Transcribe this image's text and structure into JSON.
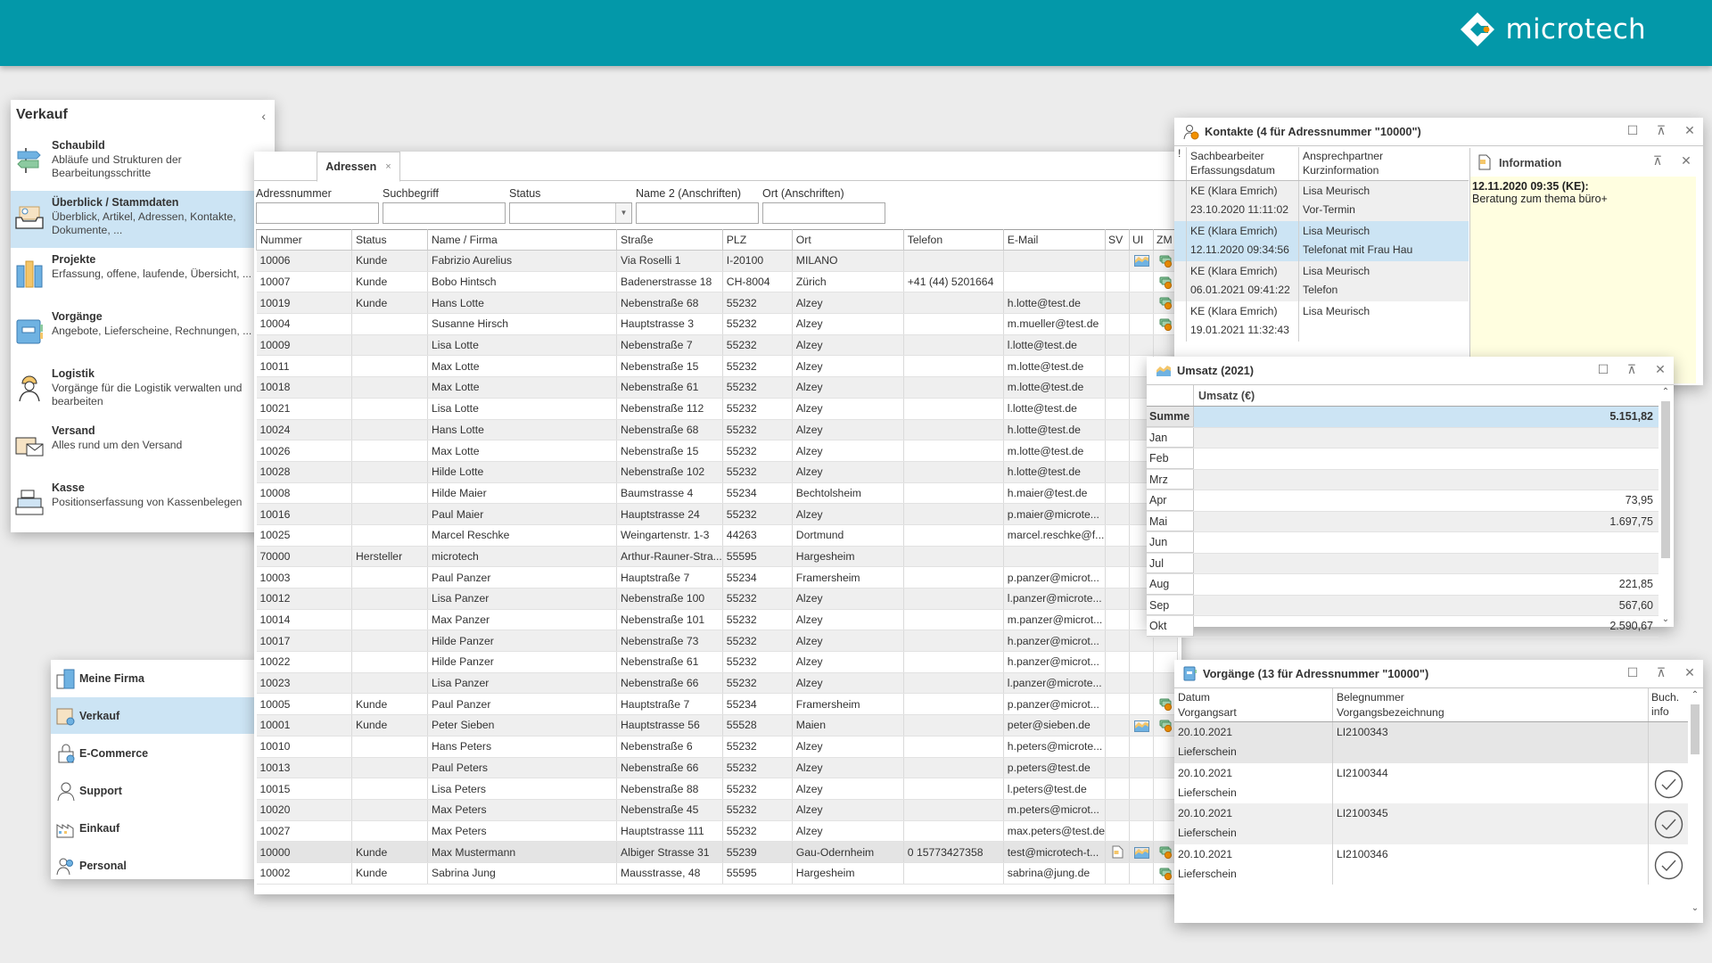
{
  "brand": {
    "name": "microtech",
    "header_color": "#0398a9",
    "accent_orange": "#f29100",
    "selection_color": "#cce4f4"
  },
  "module_panel": {
    "title": "Verkauf",
    "collapse_icon": "chevron-left-icon",
    "items": [
      {
        "title": "Schaubild",
        "desc": "Abläufe und Strukturen der Bearbeitungsschritte",
        "icon": "signpost-icon",
        "active": false
      },
      {
        "title": "Überblick / Stammdaten",
        "desc": "Überblick, Artikel, Adressen, Kontakte, Dokumente, ...",
        "icon": "address-card-icon",
        "active": true
      },
      {
        "title": "Projekte",
        "desc": "Erfassung, offene, laufende, Übersicht, ...",
        "icon": "binders-icon",
        "active": false
      },
      {
        "title": "Vorgänge",
        "desc": "Angebote, Lieferscheine, Rechnungen, ...",
        "icon": "folder-icon",
        "active": false
      },
      {
        "title": "Logistik",
        "desc": "Vorgänge für die Logistik verwalten und bearbeiten",
        "icon": "worker-icon",
        "active": false
      },
      {
        "title": "Versand",
        "desc": "Alles rund um den Versand",
        "icon": "shipping-icon",
        "active": false
      },
      {
        "title": "Kasse",
        "desc": "Positionserfassung von Kassenbelegen",
        "icon": "cash-register-icon",
        "active": false
      }
    ]
  },
  "nav": {
    "items": [
      {
        "label": "Meine Firma",
        "icon": "building-icon",
        "active": false
      },
      {
        "label": "Verkauf",
        "icon": "box-search-icon",
        "active": true
      },
      {
        "label": "E-Commerce",
        "icon": "shop-icon",
        "active": false
      },
      {
        "label": "Support",
        "icon": "user-support-icon",
        "active": false
      },
      {
        "label": "Einkauf",
        "icon": "factory-icon",
        "active": false
      },
      {
        "label": "Personal",
        "icon": "people-icon",
        "active": false
      }
    ]
  },
  "adressen": {
    "tab_label": "Adressen",
    "tab_close": "×",
    "filters": [
      {
        "label": "Adressnummer",
        "value": "",
        "type": "text"
      },
      {
        "label": "Suchbegriff",
        "value": "",
        "type": "text"
      },
      {
        "label": "Status",
        "value": "",
        "type": "select"
      },
      {
        "label": "Name 2 (Anschriften)",
        "value": "",
        "type": "text"
      },
      {
        "label": "Ort (Anschriften)",
        "value": "",
        "type": "text"
      }
    ],
    "columns": [
      "Nummer",
      "Status",
      "Name / Firma",
      "Straße",
      "PLZ",
      "Ort",
      "Telefon",
      "E-Mail",
      "SV",
      "UI",
      "ZM"
    ],
    "rows": [
      {
        "nr": "10006",
        "status": "Kunde",
        "name": "Fabrizio Aurelius",
        "strasse": "Via Roselli 1",
        "plz": "I-20100",
        "ort": "MILANO",
        "tel": "",
        "mail": "",
        "sv": "",
        "ui": "chart",
        "zm": "coins"
      },
      {
        "nr": "10007",
        "status": "Kunde",
        "name": "Bobo Hintsch",
        "strasse": "Badenerstrasse 18",
        "plz": "CH-8004",
        "ort": "Zürich",
        "tel": "+41 (44) 5201664",
        "mail": "",
        "sv": "",
        "ui": "",
        "zm": "coins"
      },
      {
        "nr": "10019",
        "status": "Kunde",
        "name": "Hans Lotte",
        "strasse": "Nebenstraße 68",
        "plz": "55232",
        "ort": "Alzey",
        "tel": "",
        "mail": "h.lotte@test.de",
        "sv": "",
        "ui": "",
        "zm": "coins"
      },
      {
        "nr": "10004",
        "status": "",
        "name": "Susanne Hirsch",
        "strasse": "Hauptstrasse 3",
        "plz": "55232",
        "ort": "Alzey",
        "tel": "",
        "mail": "m.mueller@test.de",
        "sv": "",
        "ui": "",
        "zm": "coins"
      },
      {
        "nr": "10009",
        "status": "",
        "name": "Lisa Lotte",
        "strasse": "Nebenstraße 7",
        "plz": "55232",
        "ort": "Alzey",
        "tel": "",
        "mail": "l.lotte@test.de",
        "sv": "",
        "ui": "",
        "zm": ""
      },
      {
        "nr": "10011",
        "status": "",
        "name": "Max Lotte",
        "strasse": "Nebenstraße 15",
        "plz": "55232",
        "ort": "Alzey",
        "tel": "",
        "mail": "m.lotte@test.de",
        "sv": "",
        "ui": "",
        "zm": ""
      },
      {
        "nr": "10018",
        "status": "",
        "name": "Max Lotte",
        "strasse": "Nebenstraße 61",
        "plz": "55232",
        "ort": "Alzey",
        "tel": "",
        "mail": "m.lotte@test.de",
        "sv": "",
        "ui": "",
        "zm": ""
      },
      {
        "nr": "10021",
        "status": "",
        "name": "Lisa Lotte",
        "strasse": "Nebenstraße 112",
        "plz": "55232",
        "ort": "Alzey",
        "tel": "",
        "mail": "l.lotte@test.de",
        "sv": "",
        "ui": "",
        "zm": ""
      },
      {
        "nr": "10024",
        "status": "",
        "name": "Hans Lotte",
        "strasse": "Nebenstraße 68",
        "plz": "55232",
        "ort": "Alzey",
        "tel": "",
        "mail": "h.lotte@test.de",
        "sv": "",
        "ui": "",
        "zm": ""
      },
      {
        "nr": "10026",
        "status": "",
        "name": "Max Lotte",
        "strasse": "Nebenstraße 15",
        "plz": "55232",
        "ort": "Alzey",
        "tel": "",
        "mail": "m.lotte@test.de",
        "sv": "",
        "ui": "",
        "zm": ""
      },
      {
        "nr": "10028",
        "status": "",
        "name": "Hilde Lotte",
        "strasse": "Nebenstraße 102",
        "plz": "55232",
        "ort": "Alzey",
        "tel": "",
        "mail": "h.lotte@test.de",
        "sv": "",
        "ui": "",
        "zm": ""
      },
      {
        "nr": "10008",
        "status": "",
        "name": "Hilde Maier",
        "strasse": "Baumstrasse 4",
        "plz": "55234",
        "ort": "Bechtolsheim",
        "tel": "",
        "mail": "h.maier@test.de",
        "sv": "",
        "ui": "",
        "zm": ""
      },
      {
        "nr": "10016",
        "status": "",
        "name": "Paul Maier",
        "strasse": "Hauptstrasse 24",
        "plz": "55232",
        "ort": "Alzey",
        "tel": "",
        "mail": "p.maier@microte...",
        "sv": "",
        "ui": "",
        "zm": ""
      },
      {
        "nr": "10025",
        "status": "",
        "name": "Marcel Reschke",
        "strasse": "Weingartenstr. 1-3",
        "plz": "44263",
        "ort": "Dortmund",
        "tel": "",
        "mail": "marcel.reschke@f...",
        "sv": "",
        "ui": "",
        "zm": ""
      },
      {
        "nr": "70000",
        "status": "Hersteller",
        "name": "microtech",
        "strasse": "Arthur-Rauner-Stra...",
        "plz": "55595",
        "ort": "Hargesheim",
        "tel": "",
        "mail": "",
        "sv": "",
        "ui": "",
        "zm": ""
      },
      {
        "nr": "10003",
        "status": "",
        "name": "Paul Panzer",
        "strasse": "Hauptstraße 7",
        "plz": "55234",
        "ort": "Framersheim",
        "tel": "",
        "mail": "p.panzer@microt...",
        "sv": "",
        "ui": "",
        "zm": ""
      },
      {
        "nr": "10012",
        "status": "",
        "name": "Lisa Panzer",
        "strasse": "Nebenstraße 100",
        "plz": "55232",
        "ort": "Alzey",
        "tel": "",
        "mail": "l.panzer@microte...",
        "sv": "",
        "ui": "",
        "zm": ""
      },
      {
        "nr": "10014",
        "status": "",
        "name": "Max Panzer",
        "strasse": "Nebenstraße 101",
        "plz": "55232",
        "ort": "Alzey",
        "tel": "",
        "mail": "m.panzer@microt...",
        "sv": "",
        "ui": "",
        "zm": ""
      },
      {
        "nr": "10017",
        "status": "",
        "name": "Hilde Panzer",
        "strasse": "Nebenstraße 73",
        "plz": "55232",
        "ort": "Alzey",
        "tel": "",
        "mail": "h.panzer@microt...",
        "sv": "",
        "ui": "",
        "zm": ""
      },
      {
        "nr": "10022",
        "status": "",
        "name": "Hilde Panzer",
        "strasse": "Nebenstraße 61",
        "plz": "55232",
        "ort": "Alzey",
        "tel": "",
        "mail": "h.panzer@microt...",
        "sv": "",
        "ui": "",
        "zm": ""
      },
      {
        "nr": "10023",
        "status": "",
        "name": "Lisa Panzer",
        "strasse": "Nebenstraße 66",
        "plz": "55232",
        "ort": "Alzey",
        "tel": "",
        "mail": "l.panzer@microte...",
        "sv": "",
        "ui": "",
        "zm": ""
      },
      {
        "nr": "10005",
        "status": "Kunde",
        "name": "Paul Panzer",
        "strasse": "Hauptstraße 7",
        "plz": "55234",
        "ort": "Framersheim",
        "tel": "",
        "mail": "p.panzer@microt...",
        "sv": "",
        "ui": "",
        "zm": "coins"
      },
      {
        "nr": "10001",
        "status": "Kunde",
        "name": "Peter Sieben",
        "strasse": "Hauptstrasse 56",
        "plz": "55528",
        "ort": "Maien",
        "tel": "",
        "mail": "peter@sieben.de",
        "sv": "",
        "ui": "chart",
        "zm": "coins"
      },
      {
        "nr": "10010",
        "status": "",
        "name": "Hans Peters",
        "strasse": "Nebenstraße 6",
        "plz": "55232",
        "ort": "Alzey",
        "tel": "",
        "mail": "h.peters@microte...",
        "sv": "",
        "ui": "",
        "zm": ""
      },
      {
        "nr": "10013",
        "status": "",
        "name": "Paul Peters",
        "strasse": "Nebenstraße 66",
        "plz": "55232",
        "ort": "Alzey",
        "tel": "",
        "mail": "p.peters@test.de",
        "sv": "",
        "ui": "",
        "zm": ""
      },
      {
        "nr": "10015",
        "status": "",
        "name": "Lisa Peters",
        "strasse": "Nebenstraße 88",
        "plz": "55232",
        "ort": "Alzey",
        "tel": "",
        "mail": "l.peters@test.de",
        "sv": "",
        "ui": "",
        "zm": ""
      },
      {
        "nr": "10020",
        "status": "",
        "name": "Max Peters",
        "strasse": "Nebenstraße 45",
        "plz": "55232",
        "ort": "Alzey",
        "tel": "",
        "mail": "m.peters@microt...",
        "sv": "",
        "ui": "",
        "zm": ""
      },
      {
        "nr": "10027",
        "status": "",
        "name": "Max Peters",
        "strasse": "Hauptstrasse 111",
        "plz": "55232",
        "ort": "Alzey",
        "tel": "",
        "mail": "max.peters@test.de",
        "sv": "",
        "ui": "",
        "zm": ""
      },
      {
        "nr": "10000",
        "status": "Kunde",
        "name": "Max Mustermann",
        "strasse": "Albiger Strasse 31",
        "plz": "55239",
        "ort": "Gau-Odernheim",
        "tel": "0 15773427358",
        "mail": "test@microtech-t...",
        "sv": "doc",
        "ui": "chart",
        "zm": "coins",
        "selected": true
      },
      {
        "nr": "10002",
        "status": "Kunde",
        "name": "Sabrina Jung",
        "strasse": "Mausstrasse, 48",
        "plz": "55595",
        "ort": "Hargesheim",
        "tel": "",
        "mail": "sabrina@jung.de",
        "sv": "",
        "ui": "",
        "zm": "coins"
      }
    ]
  },
  "kontakte": {
    "title": "Kontakte (4 für Adressnummer \"10000\")",
    "col_flag": "!",
    "col1": [
      "Sachbearbeiter",
      "Erfassungsdatum"
    ],
    "col2": [
      "Ansprechpartner",
      "Kurzinformation"
    ],
    "rows": [
      {
        "bearbeiter": "KE (Klara Emrich)",
        "datum": "23.10.2020 11:11:02",
        "partner": "Lisa Meurisch",
        "info": "Vor-Termin",
        "selected": false
      },
      {
        "bearbeiter": "KE (Klara Emrich)",
        "datum": "12.11.2020 09:34:56",
        "partner": "Lisa Meurisch",
        "info": "Telefonat mit Frau Hau",
        "selected": true
      },
      {
        "bearbeiter": "KE (Klara Emrich)",
        "datum": "06.01.2021 09:41:22",
        "partner": "Lisa Meurisch",
        "info": "Telefon",
        "selected": false
      },
      {
        "bearbeiter": "KE (Klara Emrich)",
        "datum": "19.01.2021 11:32:43",
        "partner": "Lisa Meurisch",
        "info": "",
        "selected": false
      }
    ],
    "information": {
      "title": "Information",
      "heading": "12.11.2020 09:35 (KE):",
      "text": "Beratung zum thema büro+"
    }
  },
  "umsatz": {
    "title": "Umsatz (2021)",
    "column": "Umsatz (€)",
    "sum_label": "Summe",
    "sum_value": "5.151,82",
    "months": [
      {
        "m": "Jan",
        "v": ""
      },
      {
        "m": "Feb",
        "v": ""
      },
      {
        "m": "Mrz",
        "v": ""
      },
      {
        "m": "Apr",
        "v": "73,95"
      },
      {
        "m": "Mai",
        "v": "1.697,75"
      },
      {
        "m": "Jun",
        "v": ""
      },
      {
        "m": "Jul",
        "v": ""
      },
      {
        "m": "Aug",
        "v": "221,85"
      },
      {
        "m": "Sep",
        "v": "567,60"
      },
      {
        "m": "Okt",
        "v": "2.590,67"
      }
    ]
  },
  "vorgaenge": {
    "title": "Vorgänge (13 für Adressnummer \"10000\")",
    "col1": [
      "Datum",
      "Vorgangsart"
    ],
    "col2": [
      "Belegnummer",
      "Vorgangsbezeichnung"
    ],
    "col3": [
      "Buch.",
      "info"
    ],
    "rows": [
      {
        "datum": "20.10.2021",
        "art": "Lieferschein",
        "beleg": "LI2100343",
        "bez": "",
        "booked": false
      },
      {
        "datum": "20.10.2021",
        "art": "Lieferschein",
        "beleg": "LI2100344",
        "bez": "",
        "booked": true
      },
      {
        "datum": "20.10.2021",
        "art": "Lieferschein",
        "beleg": "LI2100345",
        "bez": "",
        "booked": true
      },
      {
        "datum": "20.10.2021",
        "art": "Lieferschein",
        "beleg": "LI2100346",
        "bez": "",
        "booked": true
      }
    ]
  },
  "window_controls": {
    "maximize": "☐",
    "pin": "⊼",
    "close": "✕"
  }
}
